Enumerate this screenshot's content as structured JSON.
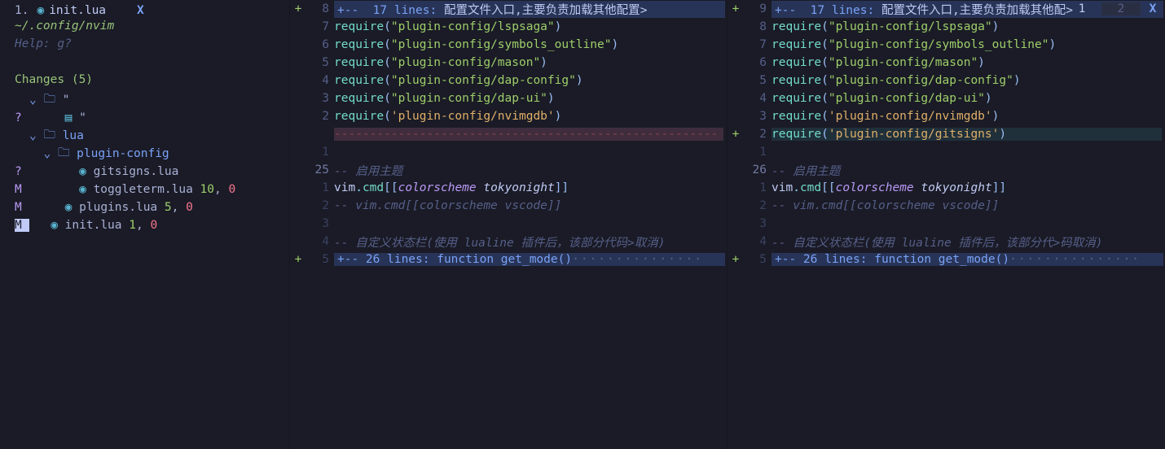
{
  "tabline": {
    "num": "1.",
    "filename": "init.lua",
    "close": "X"
  },
  "sidebar": {
    "path": "~/.config/nvim",
    "help": "Help: g?",
    "changes_header": "Changes (5)",
    "root_dir": "\"",
    "tree": {
      "quote2": "\"",
      "lua": "lua",
      "plugin_config": "plugin-config",
      "gitsigns": "gitsigns.lua",
      "toggleterm": "toggleterm.lua",
      "toggleterm_add": "10",
      "toggleterm_del": "0",
      "plugins": "plugins.lua",
      "plugins_add": "5",
      "plugins_del": "0",
      "init": "init.lua",
      "init_add": "1",
      "init_del": "0"
    },
    "status": {
      "q": "?",
      "m": "M"
    }
  },
  "topright": {
    "tab1": "1",
    "tab2": "2",
    "close": "X"
  },
  "pane_left": {
    "fold1": {
      "sign": "+",
      "lnum": "8",
      "text_pre": "+--  17 lines: ",
      "text_cn": "配置文件入口,主要负责加载其他配置",
      "arrow": ">"
    },
    "l7": {
      "lnum": "7",
      "str": "\"plugin-config/lspsaga\""
    },
    "l6": {
      "lnum": "6",
      "str": "\"plugin-config/symbols_outline\""
    },
    "l5": {
      "lnum": "5",
      "str": "\"plugin-config/mason\""
    },
    "l4": {
      "lnum": "4",
      "str": "\"plugin-config/dap-config\""
    },
    "l3": {
      "lnum": "3",
      "str": "\"plugin-config/dap-ui\""
    },
    "l2": {
      "lnum": "2",
      "str": "'plugin-config/nvimgdb'"
    },
    "del_dashes": "------------------------------------------------------",
    "l_blank": {
      "lnum": "1"
    },
    "l25": {
      "lnum": "25",
      "comment": "-- 启用主题"
    },
    "lvim1": {
      "lnum": "1",
      "ident": "vim",
      "cmd": "cmd",
      "scheme": "colorscheme",
      "theme": "tokyonight"
    },
    "lvim2": {
      "lnum": "2",
      "comment": "-- vim.cmd[[colorscheme vscode]]"
    },
    "l_blank2": {
      "lnum": "3"
    },
    "l4c": {
      "lnum": "4",
      "comment": "-- 自定义状态栏(使用 lualine 插件后，该部分代码>取消)"
    },
    "fold2": {
      "sign": "+",
      "lnum": "5",
      "text": "+-- 26 lines: function get_mode()"
    }
  },
  "pane_right": {
    "fold1": {
      "sign": "+",
      "lnum": "9",
      "text_pre": "+--  17 lines: ",
      "text_cn": "配置文件入口,主要负责加载其他配",
      "arrow": ">"
    },
    "l8": {
      "lnum": "8",
      "str": "\"plugin-config/lspsaga\""
    },
    "l7": {
      "lnum": "7",
      "str": "\"plugin-config/symbols_outline\""
    },
    "l6": {
      "lnum": "6",
      "str": "\"plugin-config/mason\""
    },
    "l5": {
      "lnum": "5",
      "str": "\"plugin-config/dap-config\""
    },
    "l4": {
      "lnum": "4",
      "str": "\"plugin-config/dap-ui\""
    },
    "l3": {
      "lnum": "3",
      "str": "'plugin-config/nvimgdb'"
    },
    "l2": {
      "sign": "+",
      "lnum": "2",
      "str": "'plugin-config/gitsigns'"
    },
    "l_blank": {
      "lnum": "1"
    },
    "l26": {
      "lnum": "26",
      "comment": "-- 启用主题"
    },
    "lvim1": {
      "lnum": "1",
      "ident": "vim",
      "cmd": "cmd",
      "scheme": "colorscheme",
      "theme": "tokyonight"
    },
    "lvim2": {
      "lnum": "2",
      "comment": "-- vim.cmd[[colorscheme vscode]]"
    },
    "l_blank2": {
      "lnum": "3"
    },
    "l4c": {
      "lnum": "4",
      "comment": "-- 自定义状态栏(使用 lualine 插件后，该部分代>码取消)"
    },
    "fold2": {
      "sign": "+",
      "lnum": "5",
      "text": "+-- 26 lines: function get_mode()"
    }
  },
  "code_common": {
    "require": "require"
  }
}
